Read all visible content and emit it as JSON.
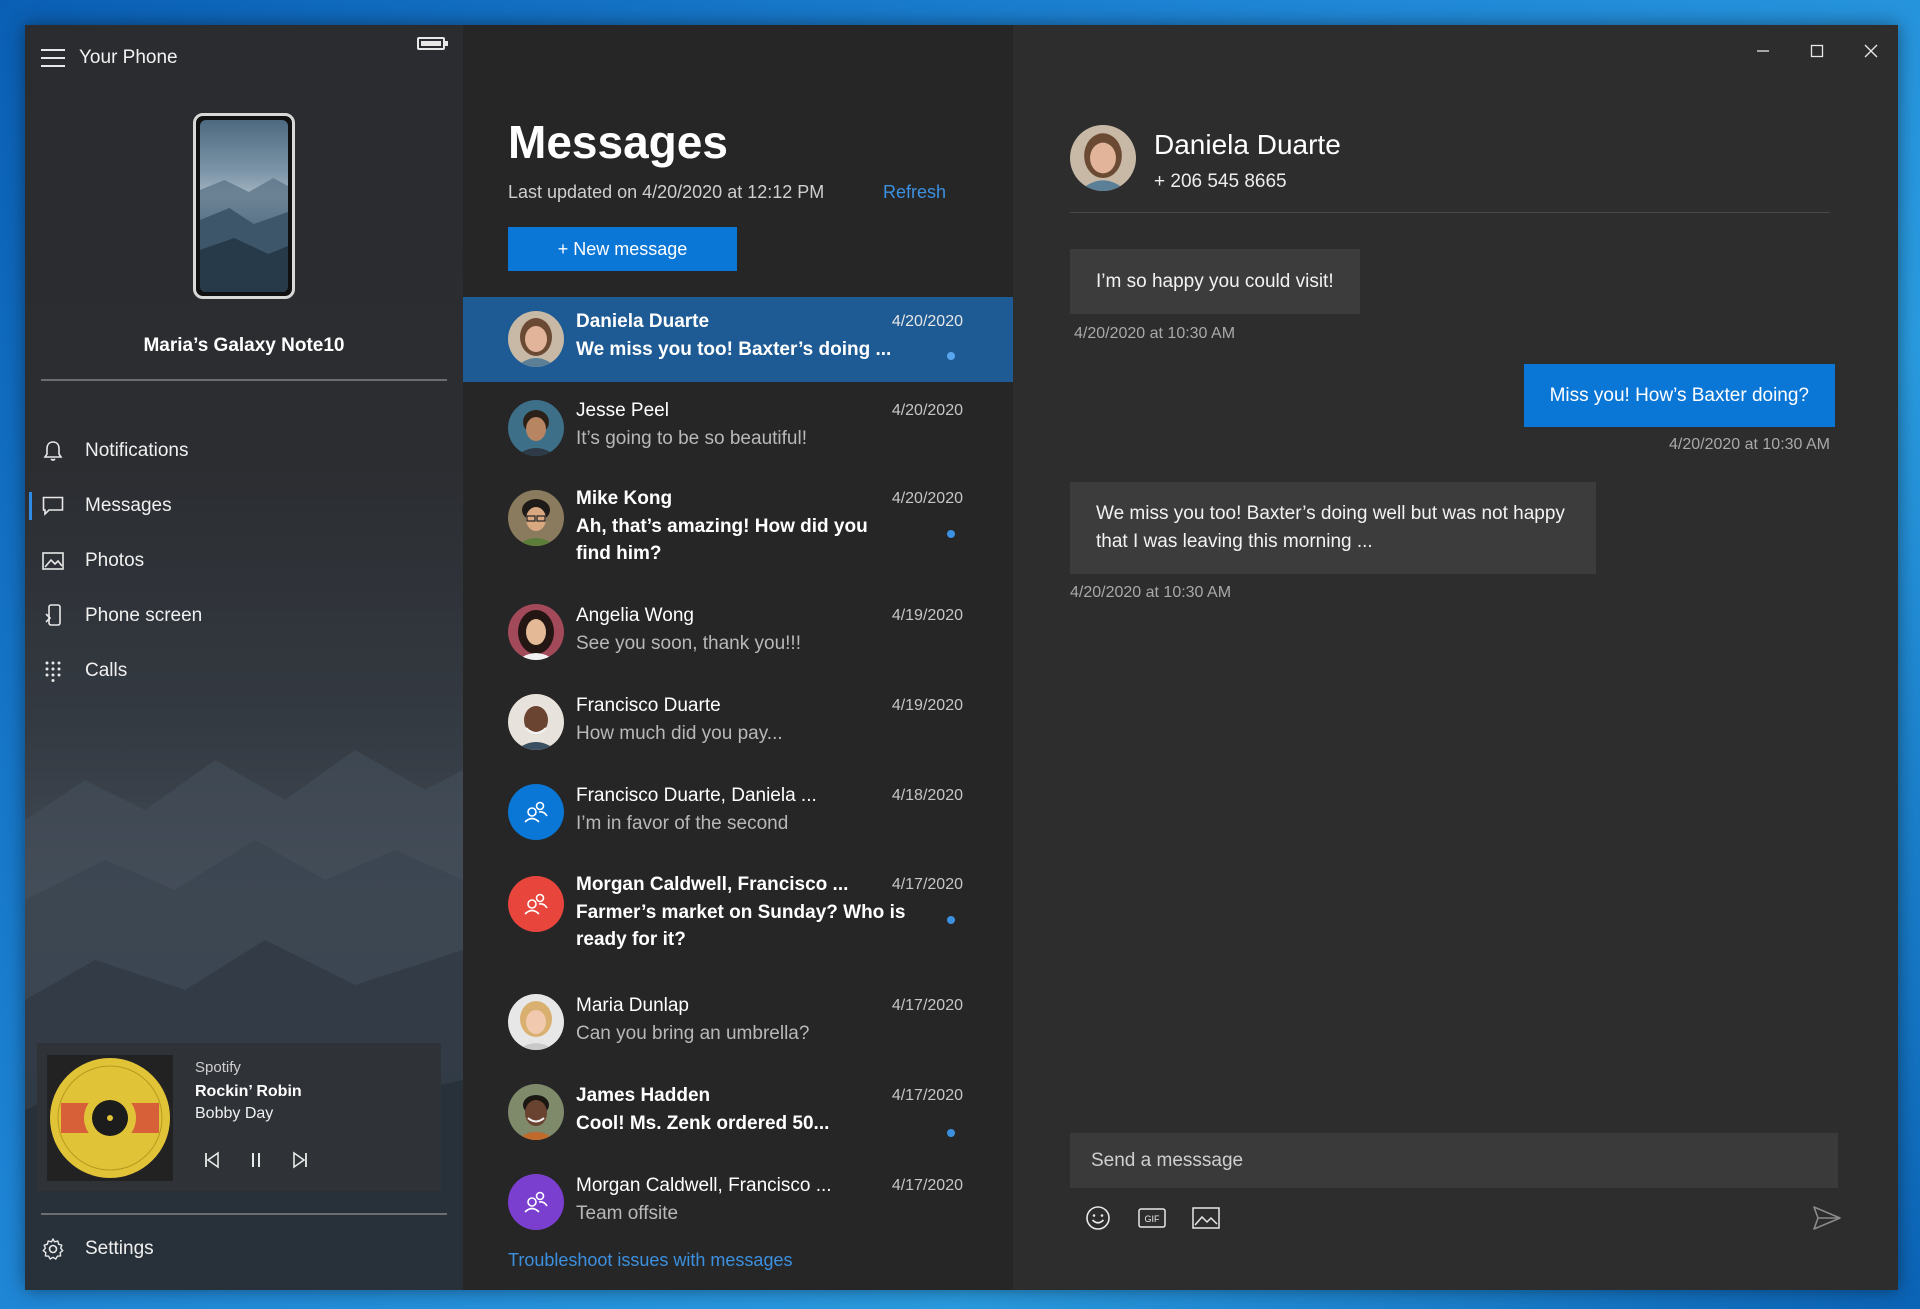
{
  "app": {
    "title": "Your Phone"
  },
  "device": {
    "name": "Maria’s Galaxy Note10"
  },
  "nav": {
    "items": [
      {
        "label": "Notifications",
        "icon": "bell-icon"
      },
      {
        "label": "Messages",
        "icon": "chat-icon",
        "active": true
      },
      {
        "label": "Photos",
        "icon": "photo-icon"
      },
      {
        "label": "Phone screen",
        "icon": "phone-screen-icon"
      },
      {
        "label": "Calls",
        "icon": "dialpad-icon"
      }
    ],
    "settings_label": "Settings"
  },
  "media": {
    "source": "Spotify",
    "title": "Rockin’ Robin",
    "artist": "Bobby Day"
  },
  "messages": {
    "title": "Messages",
    "last_updated": "Last updated on 4/20/2020 at 12:12 PM",
    "refresh_label": "Refresh",
    "new_message_label": "+ New message",
    "troubleshoot_label": "Troubleshoot issues with messages",
    "conversations": [
      {
        "name": "Daniela Duarte",
        "date": "4/20/2020",
        "preview": "We miss you too! Baxter’s doing ...",
        "unread": true,
        "selected": true
      },
      {
        "name": "Jesse Peel",
        "date": "4/20/2020",
        "preview": "It’s going to be so beautiful!",
        "unread": false
      },
      {
        "name": "Mike Kong",
        "date": "4/20/2020",
        "preview": "Ah, that’s amazing! How did you find him?",
        "unread": true
      },
      {
        "name": "Angelia Wong",
        "date": "4/19/2020",
        "preview": "See you soon, thank you!!!",
        "unread": false
      },
      {
        "name": "Francisco Duarte",
        "date": "4/19/2020",
        "preview": "How much did you pay...",
        "unread": false
      },
      {
        "name": "Francisco Duarte, Daniela ...",
        "date": "4/18/2020",
        "preview": "I’m in favor of the second",
        "unread": false,
        "group_color": "#0a76d6"
      },
      {
        "name": "Morgan Caldwell, Francisco ...",
        "date": "4/17/2020",
        "preview": "Farmer’s market on Sunday? Who is ready for it?",
        "unread": true,
        "group_color": "#e8453c"
      },
      {
        "name": "Maria Dunlap",
        "date": "4/17/2020",
        "preview": "Can you bring an umbrella?",
        "unread": false
      },
      {
        "name": "James Hadden",
        "date": "4/17/2020",
        "preview": "Cool! Ms. Zenk ordered 50...",
        "unread": true
      },
      {
        "name": "Morgan Caldwell, Francisco ...",
        "date": "4/17/2020",
        "preview": "Team offsite",
        "unread": false,
        "group_color": "#7b3fd0"
      }
    ]
  },
  "chat": {
    "contact_name": "Daniela Duarte",
    "contact_phone": "+ 206 545 8665",
    "bubbles": [
      {
        "direction": "in",
        "text": "I’m so happy you could visit!",
        "time": "4/20/2020 at 10:30 AM"
      },
      {
        "direction": "out",
        "text": "Miss you! How’s Baxter doing?",
        "time": "4/20/2020 at 10:30 AM"
      },
      {
        "direction": "in",
        "text": "We miss you too! Baxter’s doing well but was not happy that I was leaving this morning ...",
        "time": "4/20/2020 at 10:30 AM"
      }
    ],
    "compose_placeholder": "Send a messsage"
  },
  "colors": {
    "accent": "#0a76d6",
    "link": "#3c90e0",
    "selected_row": "#1e5b94"
  }
}
